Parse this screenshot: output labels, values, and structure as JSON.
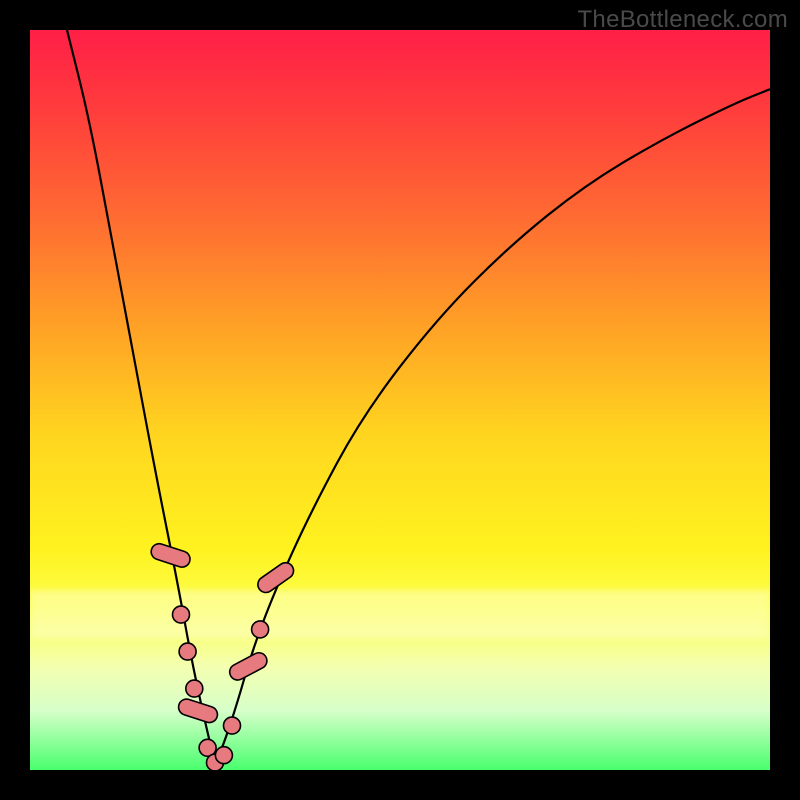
{
  "watermark": "TheBottleneck.com",
  "colors": {
    "top": "#ff1f47",
    "mid": "#ffd61f",
    "bottom": "#49ff6e",
    "curve": "#000000",
    "bead_fill": "#e77a7e",
    "bead_stroke": "#000000"
  },
  "chart_data": {
    "type": "line",
    "title": "",
    "xlabel": "",
    "ylabel": "",
    "xlim": [
      0,
      100
    ],
    "ylim": [
      0,
      100
    ],
    "note": "Values are read off the plot geometry; x is horizontal position (% of plot width left→right), y is bottleneck severity (% 0=green/none to 100=red/max). The curve is a V shape with its minimum near x≈25. Axes carry no numeric labels in the source image, so units are relative.",
    "series": [
      {
        "name": "bottleneck-curve",
        "x": [
          5,
          8,
          11,
          14,
          17,
          20,
          22,
          24,
          25,
          26,
          28,
          30,
          33,
          38,
          45,
          55,
          65,
          75,
          85,
          95,
          100
        ],
        "y": [
          100,
          88,
          72,
          56,
          40,
          25,
          14,
          5,
          1,
          3,
          9,
          16,
          24,
          35,
          48,
          61,
          71,
          79,
          85,
          90,
          92
        ]
      }
    ],
    "markers": {
      "name": "highlighted-points",
      "description": "Pink bead markers clustered near the curve minimum on both arms.",
      "points": [
        {
          "x": 19.0,
          "y": 29,
          "shape": "pill",
          "angle": -72
        },
        {
          "x": 20.4,
          "y": 21,
          "shape": "dot"
        },
        {
          "x": 21.3,
          "y": 16,
          "shape": "dot"
        },
        {
          "x": 22.2,
          "y": 11,
          "shape": "dot"
        },
        {
          "x": 22.7,
          "y": 8,
          "shape": "pill",
          "angle": -72
        },
        {
          "x": 24.0,
          "y": 3,
          "shape": "dot"
        },
        {
          "x": 25.0,
          "y": 1,
          "shape": "dot"
        },
        {
          "x": 26.2,
          "y": 2,
          "shape": "dot"
        },
        {
          "x": 27.3,
          "y": 6,
          "shape": "dot"
        },
        {
          "x": 29.5,
          "y": 14,
          "shape": "pill",
          "angle": 62
        },
        {
          "x": 31.1,
          "y": 19,
          "shape": "dot"
        },
        {
          "x": 33.2,
          "y": 26,
          "shape": "pill",
          "angle": 55
        }
      ]
    }
  }
}
